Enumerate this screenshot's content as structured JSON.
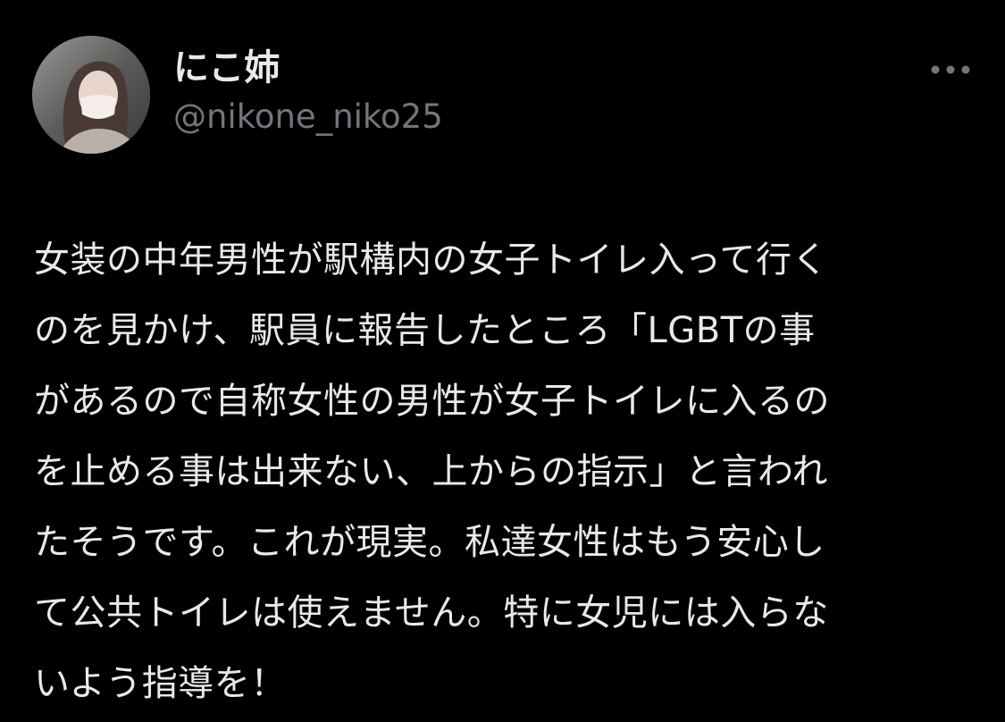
{
  "author": {
    "display_name": "にこ姉",
    "handle": "@nikone_niko25",
    "avatar_icon": "profile-photo"
  },
  "actions": {
    "more_icon": "more-horizontal-icon"
  },
  "tweet": {
    "lines": [
      "女装の中年男性が駅構内の女子トイレ入って行く",
      "のを見かけ、駅員に報告したところ「LGBTの事",
      "があるので自称女性の男性が女子トイレに入るの",
      "を止める事は出来ない、上からの指示」と言われ",
      "たそうです。これが現実。私達女性はもう安心し",
      "て公共トイレは使えません。特に女児には入らな",
      "いよう指導を！"
    ]
  },
  "colors": {
    "background": "#000000",
    "text_primary": "#e7e9ea",
    "text_secondary": "#71767b"
  }
}
